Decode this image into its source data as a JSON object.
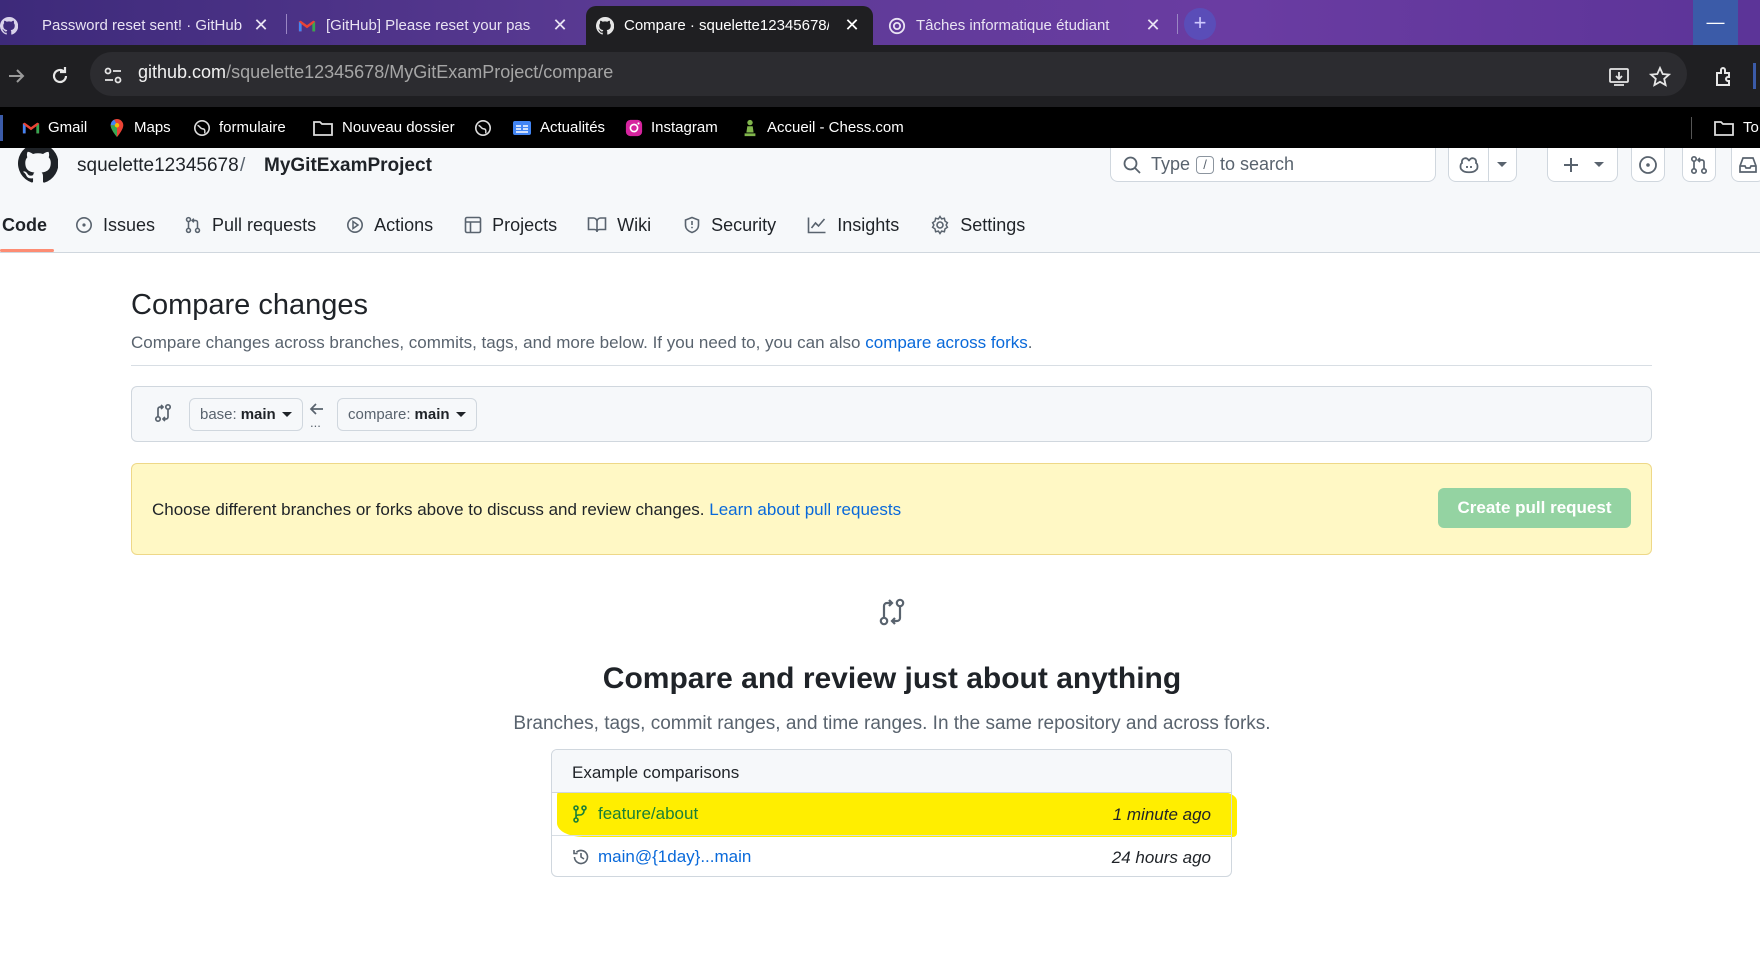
{
  "browser": {
    "tabs": [
      {
        "title": "Password reset sent! · GitHub",
        "icon": "github-icon"
      },
      {
        "title": "[GitHub] Please reset your pass",
        "icon": "gmail-icon"
      },
      {
        "title": "Compare · squelette12345678/M",
        "icon": "github-icon",
        "active": true
      },
      {
        "title": "Tâches informatique étudiant",
        "icon": "chatgpt-icon"
      }
    ],
    "url_host": "github.com",
    "url_path": "/squelette12345678/MyGitExamProject/compare",
    "bookmarks": [
      "Gmail",
      "Maps",
      "formulaire",
      "Nouveau dossier",
      "",
      "Actualités",
      "Instagram",
      "Accueil - Chess.com",
      "To"
    ]
  },
  "repo": {
    "owner": "squelette12345678",
    "separator": "/",
    "name": "MyGitExamProject"
  },
  "search": {
    "prefix": "Type",
    "key": "/",
    "suffix": "to search"
  },
  "nav": [
    "Code",
    "Issues",
    "Pull requests",
    "Actions",
    "Projects",
    "Wiki",
    "Security",
    "Insights",
    "Settings"
  ],
  "compare": {
    "title": "Compare changes",
    "subtitle": "Compare changes across branches, commits, tags, and more below. If you need to, you can also",
    "subtitle_link": "compare across forks",
    "subtitle_end": ".",
    "base_label": "base:",
    "base_value": "main",
    "compare_label": "compare:",
    "compare_value": "main",
    "dots": "...",
    "flash_text": "Choose different branches or forks above to discuss and review changes.",
    "flash_link": "Learn about pull requests",
    "create_pr": "Create pull request",
    "blank_title": "Compare and review just about anything",
    "blank_sub": "Branches, tags, commit ranges, and time ranges. In the same repository and across forks.",
    "examples_header": "Example comparisons",
    "examples": [
      {
        "label": "feature/about",
        "time": "1 minute ago",
        "icon": "git-branch-icon"
      },
      {
        "label": "main@{1day}...main",
        "time": "24 hours ago",
        "icon": "history-icon"
      }
    ],
    "highlight_color": "#ffee00"
  }
}
